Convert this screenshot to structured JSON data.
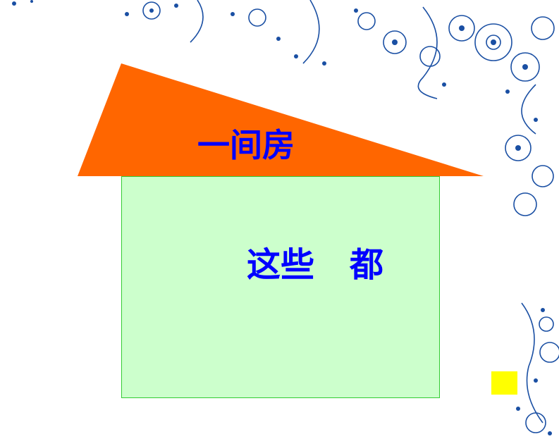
{
  "roof": {
    "label": "一间房",
    "color": "#ff6600"
  },
  "house": {
    "label_part1": "这些",
    "label_part2": "都",
    "fill": "#ccffcc",
    "border": "#33cc33"
  },
  "text_color": "#0000ff",
  "marker": {
    "color": "#ffff00"
  },
  "decoration": {
    "name": "blue-white-floral-border",
    "color": "#1a4fa3"
  }
}
